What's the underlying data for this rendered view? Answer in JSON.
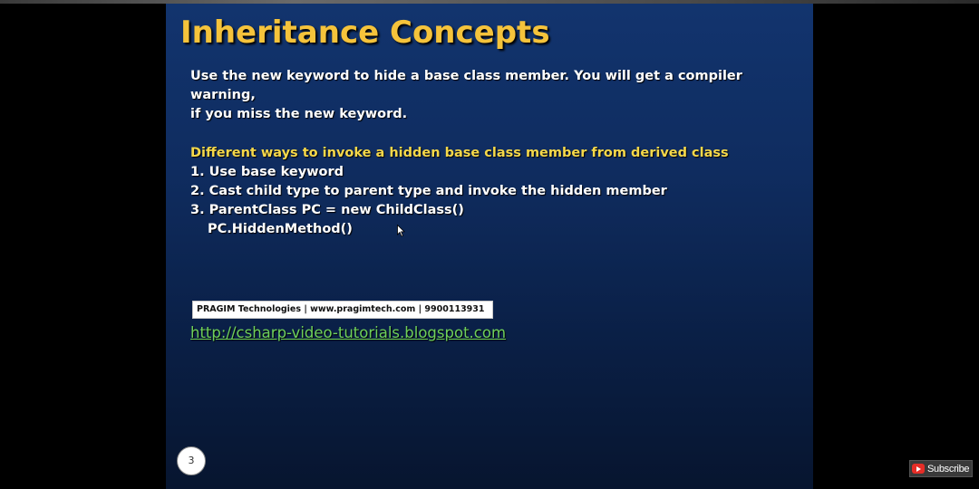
{
  "slide": {
    "title": "Inheritance Concepts",
    "intro_line1": "Use the new keyword to hide a base class member. You will get a compiler warning,",
    "intro_line2": "if you miss the new keyword.",
    "subheading": "Different ways to invoke a hidden base class member from derived class",
    "steps": [
      "1. Use base keyword",
      "2. Cast child type to parent type and invoke the hidden member",
      "3. ParentClass PC = new ChildClass()",
      "PC.HiddenMethod()"
    ],
    "banner": "PRAGIM Technologies | www.pragimtech.com | 9900113931",
    "link": "http://csharp-video-tutorials.blogspot.com",
    "page_number": "3"
  },
  "overlay": {
    "subscribe_label": "Subscribe",
    "subscribe_icon": "youtube-icon"
  },
  "colors": {
    "title": "#f5c33b",
    "subheading": "#f5d84a",
    "link": "#6fd05a",
    "slide_background": "#0f2c5f"
  }
}
